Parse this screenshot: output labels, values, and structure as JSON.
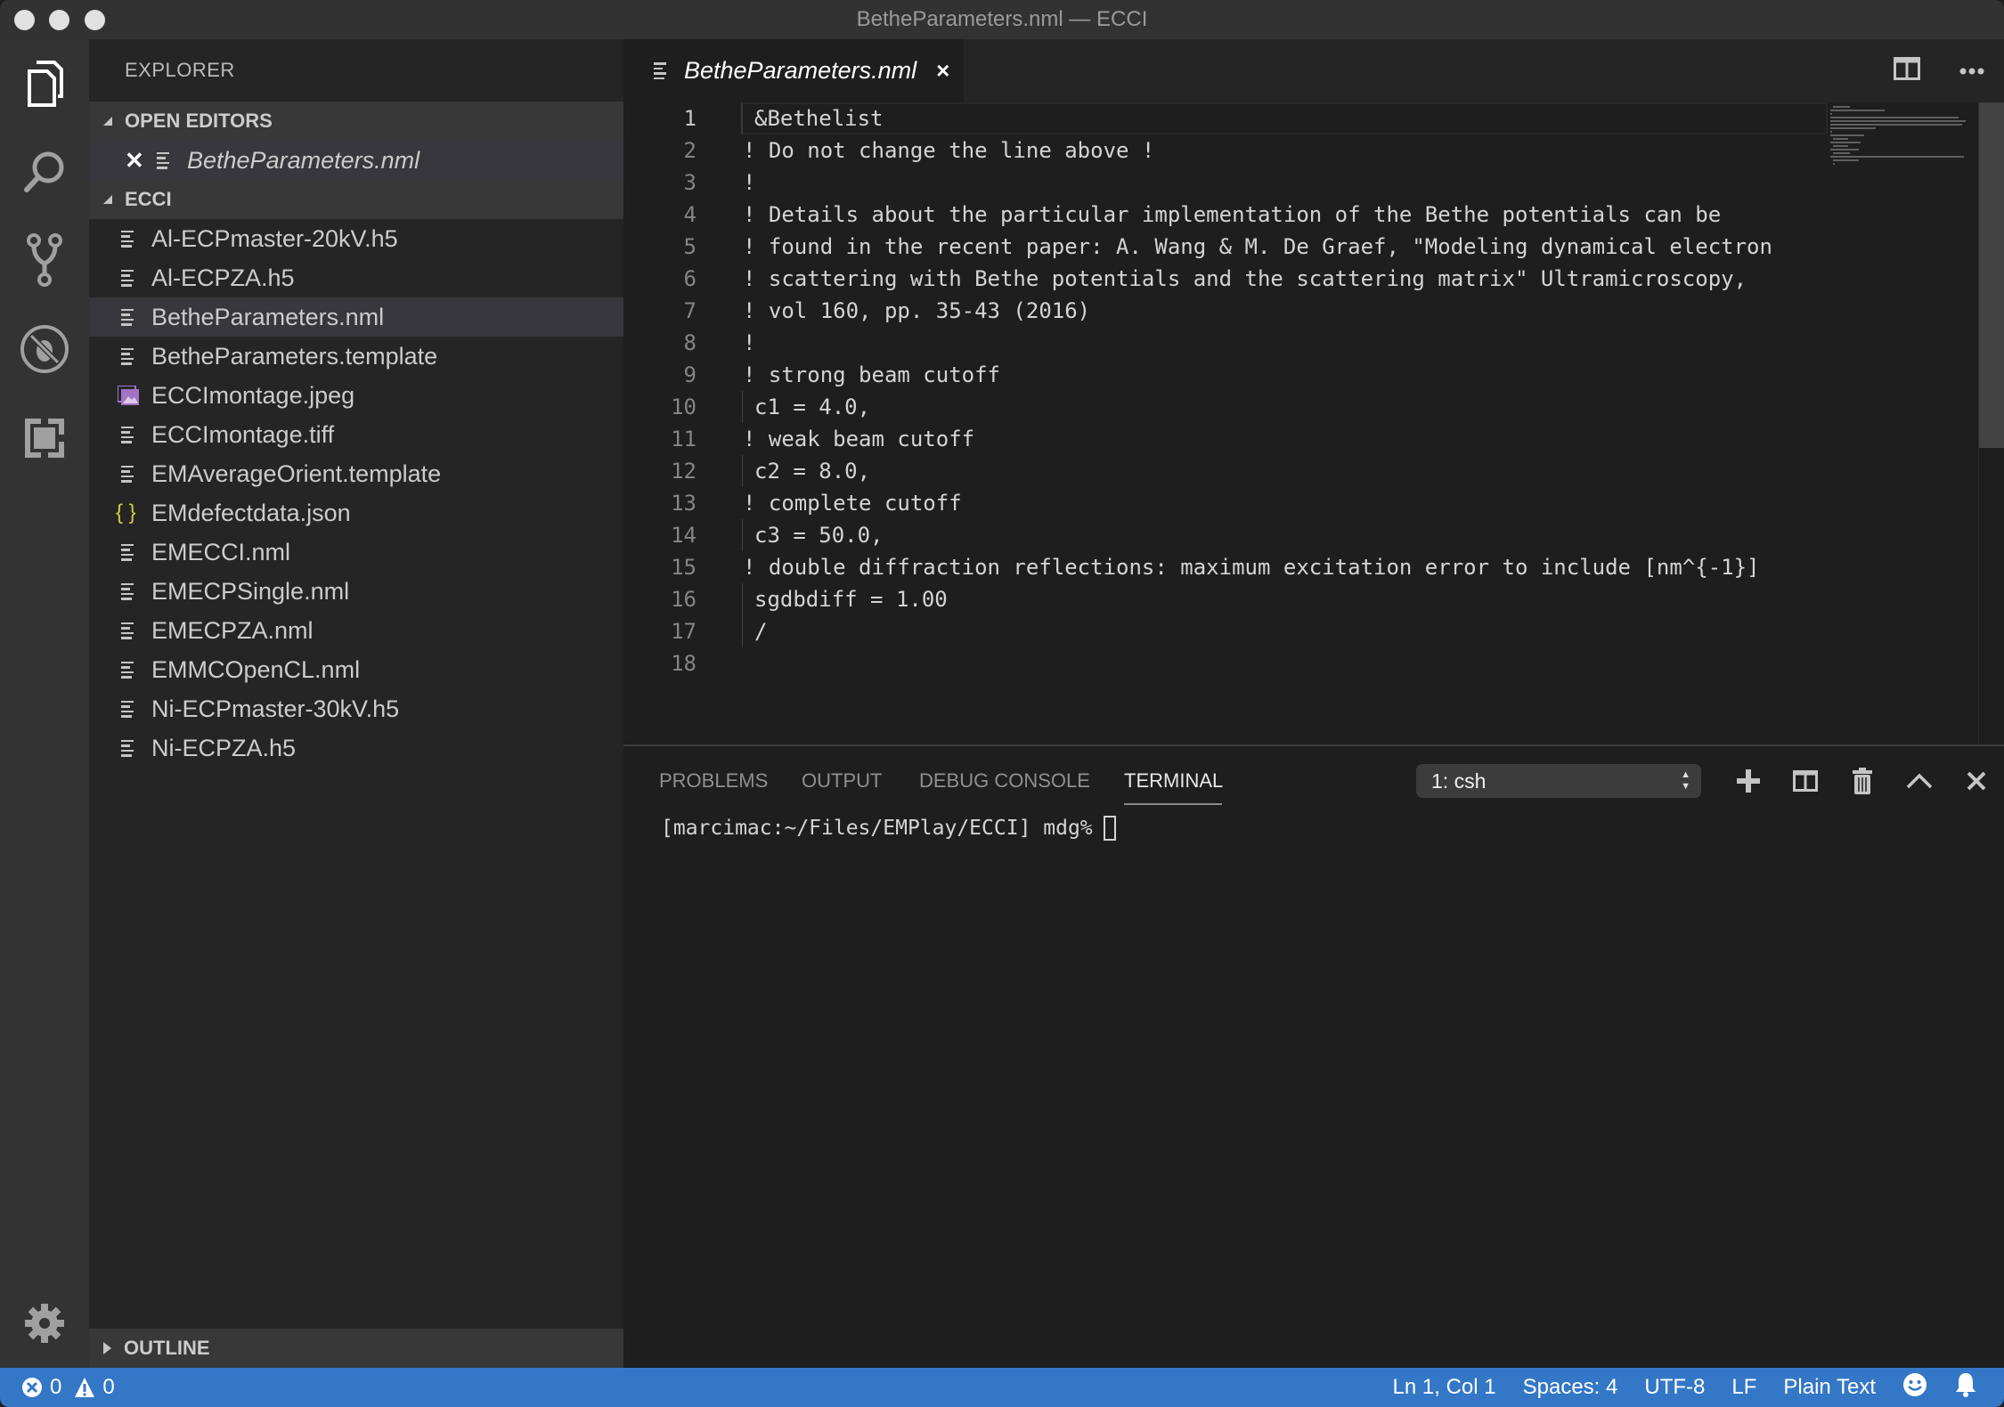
{
  "window": {
    "title": "BetheParameters.nml — ECCI"
  },
  "activity_bar": {
    "items": [
      {
        "name": "explorer",
        "icon": "files-icon",
        "active": true
      },
      {
        "name": "search",
        "icon": "search-icon"
      },
      {
        "name": "source-control",
        "icon": "source-control-icon"
      },
      {
        "name": "debug",
        "icon": "debug-icon"
      },
      {
        "name": "extensions",
        "icon": "extensions-icon"
      }
    ],
    "settings_icon": "gear-icon"
  },
  "sidebar": {
    "title": "EXPLORER",
    "open_editors": {
      "label": "OPEN EDITORS",
      "items": [
        {
          "name": "BetheParameters.nml",
          "icon": "text-file-icon"
        }
      ]
    },
    "folder": {
      "label": "ECCI",
      "files": [
        {
          "name": "Al-ECPmaster-20kV.h5",
          "icon": "text-file-icon"
        },
        {
          "name": "Al-ECPZA.h5",
          "icon": "text-file-icon"
        },
        {
          "name": "BetheParameters.nml",
          "icon": "text-file-icon",
          "selected": true
        },
        {
          "name": "BetheParameters.template",
          "icon": "text-file-icon"
        },
        {
          "name": "ECCImontage.jpeg",
          "icon": "image-file-icon"
        },
        {
          "name": "ECCImontage.tiff",
          "icon": "text-file-icon"
        },
        {
          "name": "EMAverageOrient.template",
          "icon": "text-file-icon"
        },
        {
          "name": "EMdefectdata.json",
          "icon": "json-file-icon"
        },
        {
          "name": "EMECCI.nml",
          "icon": "text-file-icon"
        },
        {
          "name": "EMECPSingle.nml",
          "icon": "text-file-icon"
        },
        {
          "name": "EMECPZA.nml",
          "icon": "text-file-icon"
        },
        {
          "name": "EMMCOpenCL.nml",
          "icon": "text-file-icon"
        },
        {
          "name": "Ni-ECPmaster-30kV.h5",
          "icon": "text-file-icon"
        },
        {
          "name": "Ni-ECPZA.h5",
          "icon": "text-file-icon"
        }
      ]
    },
    "outline_label": "OUTLINE"
  },
  "editor": {
    "tab": {
      "name": "BetheParameters.nml",
      "close": "×"
    },
    "lines": [
      {
        "n": "1",
        "text": "&Bethelist",
        "indent": true
      },
      {
        "n": "2",
        "text": "! Do not change the line above !"
      },
      {
        "n": "3",
        "text": "!"
      },
      {
        "n": "4",
        "text": "! Details about the particular implementation of the Bethe potentials can be"
      },
      {
        "n": "5",
        "text": "! found in the recent paper: A. Wang & M. De Graef, \"Modeling dynamical electron"
      },
      {
        "n": "6",
        "text": "! scattering with Bethe potentials and the scattering matrix\" Ultramicroscopy,"
      },
      {
        "n": "7",
        "text": "! vol 160, pp. 35-43 (2016)"
      },
      {
        "n": "8",
        "text": "!"
      },
      {
        "n": "9",
        "text": "! strong beam cutoff"
      },
      {
        "n": "10",
        "text": "c1 = 4.0,",
        "indent": true
      },
      {
        "n": "11",
        "text": "! weak beam cutoff"
      },
      {
        "n": "12",
        "text": "c2 = 8.0,",
        "indent": true
      },
      {
        "n": "13",
        "text": "! complete cutoff"
      },
      {
        "n": "14",
        "text": "c3 = 50.0,",
        "indent": true
      },
      {
        "n": "15",
        "text": "! double diffraction reflections: maximum excitation error to include [nm^{-1}]"
      },
      {
        "n": "16",
        "text": "sgdbdiff = 1.00",
        "indent": true
      },
      {
        "n": "17",
        "text": "/",
        "indent": true
      },
      {
        "n": "18",
        "text": ""
      }
    ]
  },
  "panel": {
    "tabs": [
      {
        "label": "PROBLEMS"
      },
      {
        "label": "OUTPUT"
      },
      {
        "label": "DEBUG CONSOLE"
      },
      {
        "label": "TERMINAL",
        "active": true
      }
    ],
    "terminal_select": "1: csh",
    "terminal_prompt": "[marcimac:~/Files/EMPlay/ECCI] mdg%"
  },
  "statusbar": {
    "errors": "0",
    "warnings": "0",
    "position": "Ln 1, Col 1",
    "indentation": "Spaces: 4",
    "encoding": "UTF-8",
    "eol": "LF",
    "language": "Plain Text"
  },
  "colors": {
    "statusbar_bg": "#3477c6",
    "sidebar_bg": "#252526",
    "editor_bg": "#1e1e1e",
    "activity_bg": "#333333",
    "json_icon": "#cbcb41",
    "image_icon": "#a074c4"
  }
}
